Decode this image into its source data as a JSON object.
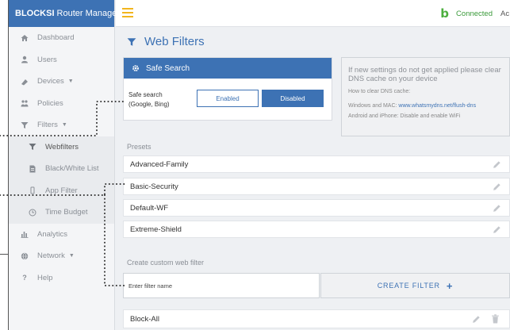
{
  "brand": {
    "bold": "BLOCKSI",
    "rest": " Router Manager"
  },
  "topbar": {
    "logo": "b",
    "status": "Connected",
    "account": "Ac"
  },
  "sidebar": {
    "items": [
      {
        "label": "Dashboard",
        "icon": "dashboard-icon"
      },
      {
        "label": "Users",
        "icon": "user-icon"
      },
      {
        "label": "Devices",
        "icon": "devices-icon",
        "caret": true
      },
      {
        "label": "Policies",
        "icon": "policies-icon"
      },
      {
        "label": "Filters",
        "icon": "filter-icon",
        "caret": true
      },
      {
        "label": "Webfilters",
        "icon": "filter-icon",
        "sub": true
      },
      {
        "label": "Black/White List",
        "icon": "list-icon"
      },
      {
        "label": "App Filter",
        "icon": "mobile-icon"
      },
      {
        "label": "Time Budget",
        "icon": "clock-icon"
      },
      {
        "label": "Analytics",
        "icon": "chart-icon"
      },
      {
        "label": "Network",
        "icon": "globe-icon",
        "caret": true
      },
      {
        "label": "Help",
        "icon": "question-icon"
      }
    ]
  },
  "page": {
    "title": "Web Filters"
  },
  "safe_search": {
    "header": "Safe Search",
    "label_line1": "Safe search",
    "label_line2": "(Google, Bing)",
    "enabled_label": "Enabled",
    "disabled_label": "Disabled",
    "selected": "Disabled"
  },
  "info": {
    "heading": "If new settings do not get applied please clear DNS cache on your device",
    "line1": "How to clear DNS cache:",
    "line2_prefix": "Windows and MAC: ",
    "line2_link": "www.whatsmydns.net/flush-dns",
    "line3": "Android and iPhone: Disable and enable WiFi"
  },
  "presets": {
    "label": "Presets",
    "items": [
      "Advanced-Family",
      "Basic-Security",
      "Default-WF",
      "Extreme-Shield"
    ]
  },
  "custom": {
    "label": "Create custom web filter",
    "placeholder": "Enter filter name",
    "create_label": "CREATE FILTER",
    "create_icon": "+",
    "items": [
      "Block-All"
    ]
  },
  "colors": {
    "brand_blue": "#3d72b4",
    "connected_green": "#3a9a3a",
    "hamburger_yellow": "#f2b51d"
  }
}
